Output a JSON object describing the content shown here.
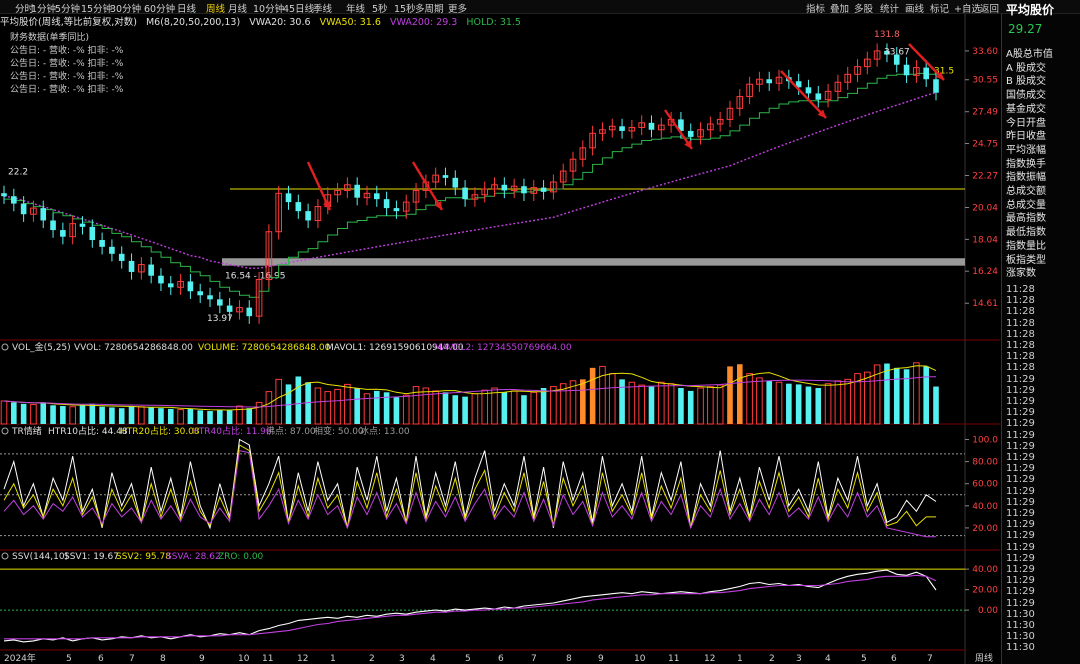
{
  "toolbar": {
    "periods": [
      "分时",
      "1分钟",
      "5分钟",
      "15分钟",
      "30分钟",
      "60分钟",
      "日线",
      "周线",
      "月线",
      "10分钟",
      "45日线",
      "季线",
      "年线",
      "5秒",
      "15秒",
      "多周期",
      "更多"
    ],
    "active": "周线",
    "right_items": [
      "指标",
      "叠加",
      "多股",
      "统计",
      "画线",
      "标记",
      "+自选",
      "返回"
    ]
  },
  "header": {
    "name": "平均股价(周线,等比前复权,对数)",
    "indicator": "M6(8,20,50,200,13)",
    "vwa20": "VWA20: 30.6",
    "vwa50": "VWA50: 31.6",
    "vwa200": "VWA200: 29.3",
    "hold": "HOLD: 31.5"
  },
  "fin_data": {
    "title": "财务数据(单季同比)",
    "rows": [
      "公告日: -   营收: -%   扣非: -%",
      "公告日: -   营收: -%   扣非: -%",
      "公告日: -   营收: -%   扣非: -%",
      "公告日: -   营收: -%   扣非: -%"
    ]
  },
  "right_panel": {
    "title": "平均股价",
    "price": "29.27",
    "items": [
      "A股总市值",
      "A 股成交",
      "B 股成交",
      "国债成交",
      "基金成交",
      "今日开盘",
      "昨日收盘",
      "平均涨幅",
      "指数换手",
      "指数振幅",
      "总成交额",
      "总成交量",
      "最高指数",
      "最低指数",
      "指数量比",
      "板指类型",
      "涨家数"
    ],
    "times": [
      "11:28",
      "11:28",
      "11:28",
      "11:28",
      "11:28",
      "11:28",
      "11:28",
      "11:28",
      "11:29",
      "11:29",
      "11:29",
      "11:29",
      "11:29",
      "11:29",
      "11:29",
      "11:29",
      "11:29",
      "11:29",
      "11:29",
      "11:29",
      "11:29",
      "11:29",
      "11:29",
      "11:29",
      "11:29",
      "11:29",
      "11:29",
      "11:29",
      "11:29",
      "11:30",
      "11:30",
      "11:30",
      "11:30"
    ]
  },
  "colors": {
    "up": "#ff3b3b",
    "down": "#55f0f0",
    "vwa20": "#2db84a",
    "vwa200": "#c040e0",
    "yellow": "#e8e000",
    "orange": "#ff8a2b"
  },
  "chart_data": [
    {
      "type": "candlestick",
      "title": "",
      "price_labels": [
        "33.60",
        "30.55",
        "27.49",
        "24.75",
        "22.27",
        "20.04",
        "18.04",
        "16.24",
        "14.61"
      ],
      "price_values": [
        33.6,
        30.55,
        27.49,
        24.75,
        22.27,
        20.04,
        18.04,
        16.24,
        14.61
      ],
      "ylim": [
        13.2,
        36.0
      ],
      "log_scale": true,
      "x_labels": [
        "2024年",
        "5",
        "6",
        "7",
        "8",
        "9",
        "10",
        "11",
        "12",
        "1",
        "2",
        "3",
        "4",
        "5",
        "6",
        "7",
        "8",
        "9",
        "10",
        "11",
        "12",
        "1",
        "2",
        "3",
        "4",
        "5",
        "6",
        "7"
      ],
      "annotations": [
        "22.2",
        "13.97",
        "16.54 - 16.95",
        "131.8",
        "33.67",
        "31.5"
      ],
      "support_band": [
        16.54,
        16.95
      ],
      "resistance_level": 21.3,
      "weeks": 96,
      "closes": [
        20.8,
        20.3,
        19.6,
        20.0,
        19.2,
        18.6,
        18.2,
        19.0,
        18.8,
        18.0,
        17.6,
        17.2,
        16.8,
        16.2,
        16.6,
        16.0,
        15.6,
        15.4,
        15.7,
        15.2,
        15.0,
        14.8,
        14.5,
        14.2,
        14.4,
        14.0,
        15.8,
        18.5,
        21.0,
        20.4,
        19.8,
        19.2,
        20.1,
        20.9,
        21.2,
        21.6,
        20.7,
        21.0,
        20.6,
        20.0,
        19.8,
        20.4,
        21.2,
        21.8,
        22.3,
        22.1,
        21.4,
        20.6,
        20.9,
        21.3,
        21.6,
        21.2,
        21.5,
        21.0,
        21.4,
        21.1,
        21.8,
        22.6,
        23.5,
        24.4,
        25.6,
        25.9,
        26.2,
        25.8,
        26.1,
        26.5,
        25.9,
        26.3,
        26.8,
        25.8,
        25.3,
        25.9,
        26.4,
        26.8,
        27.8,
        28.9,
        30.1,
        30.6,
        30.2,
        30.8,
        30.4,
        29.8,
        29.2,
        28.6,
        29.4,
        30.3,
        31.1,
        31.9,
        32.7,
        33.6,
        33.2,
        32.1,
        31.0,
        31.8,
        30.6,
        29.27
      ],
      "vwa20": [
        20.6,
        20.5,
        20.3,
        20.1,
        19.9,
        19.7,
        19.5,
        19.3,
        19.1,
        18.9,
        18.7,
        18.4,
        18.2,
        17.9,
        17.6,
        17.3,
        17.0,
        16.7,
        16.5,
        16.2,
        16.0,
        15.7,
        15.4,
        15.2,
        15.0,
        14.9,
        15.2,
        15.9,
        16.6,
        17.0,
        17.3,
        17.5,
        17.9,
        18.3,
        18.7,
        19.1,
        19.2,
        19.4,
        19.5,
        19.5,
        19.5,
        19.6,
        19.9,
        20.2,
        20.5,
        20.7,
        20.7,
        20.6,
        20.7,
        20.8,
        21.0,
        21.0,
        21.1,
        21.1,
        21.2,
        21.2,
        21.3,
        21.6,
        22.0,
        22.5,
        23.1,
        23.6,
        24.1,
        24.4,
        24.7,
        25.0,
        25.1,
        25.2,
        25.3,
        25.2,
        25.1,
        25.1,
        25.2,
        25.4,
        25.8,
        26.3,
        26.9,
        27.4,
        27.8,
        28.2,
        28.4,
        28.5,
        28.5,
        28.4,
        28.5,
        28.8,
        29.2,
        29.7,
        30.2,
        30.7,
        31.0,
        31.1,
        31.1,
        31.2,
        31.1,
        30.9
      ],
      "vwa200": [
        20.8,
        20.7,
        20.5,
        20.3,
        20.1,
        19.9,
        19.7,
        19.5,
        19.3,
        19.1,
        18.9,
        18.7,
        18.5,
        18.3,
        18.1,
        17.9,
        17.7,
        17.5,
        17.3,
        17.1,
        17.0,
        16.8,
        16.7,
        16.6,
        16.5,
        16.4,
        16.4,
        16.5,
        16.6,
        16.7,
        16.8,
        16.9,
        17.0,
        17.1,
        17.2,
        17.3,
        17.4,
        17.5,
        17.6,
        17.7,
        17.8,
        17.9,
        18.0,
        18.1,
        18.2,
        18.3,
        18.4,
        18.5,
        18.6,
        18.7,
        18.8,
        18.9,
        19.0,
        19.1,
        19.2,
        19.3,
        19.4,
        19.6,
        19.8,
        20.0,
        20.2,
        20.4,
        20.6,
        20.8,
        21.0,
        21.2,
        21.4,
        21.6,
        21.8,
        22.0,
        22.2,
        22.4,
        22.6,
        22.8,
        23.0,
        23.3,
        23.6,
        23.9,
        24.2,
        24.5,
        24.8,
        25.1,
        25.4,
        25.7,
        26.0,
        26.3,
        26.6,
        26.9,
        27.2,
        27.5,
        27.8,
        28.1,
        28.4,
        28.7,
        29.0,
        29.3
      ]
    },
    {
      "type": "bar",
      "title": "VOL_金(5,25)",
      "vvol": "VVOL: 7280654286848.00",
      "volume": "VOLUME: 7280654286848.00",
      "mavol1": "MAVOL1: 12691590610944.00",
      "mavol2": "MAVOL2: 12734550769664.00",
      "values": [
        0.32,
        0.3,
        0.28,
        0.27,
        0.3,
        0.26,
        0.25,
        0.24,
        0.26,
        0.28,
        0.24,
        0.23,
        0.22,
        0.25,
        0.24,
        0.23,
        0.22,
        0.21,
        0.2,
        0.21,
        0.19,
        0.18,
        0.2,
        0.19,
        0.25,
        0.22,
        0.3,
        0.45,
        0.62,
        0.55,
        0.66,
        0.58,
        0.5,
        0.45,
        0.48,
        0.55,
        0.5,
        0.42,
        0.46,
        0.44,
        0.38,
        0.4,
        0.52,
        0.5,
        0.46,
        0.44,
        0.4,
        0.38,
        0.42,
        0.47,
        0.5,
        0.44,
        0.46,
        0.4,
        0.44,
        0.5,
        0.52,
        0.56,
        0.6,
        0.62,
        0.78,
        0.8,
        0.7,
        0.62,
        0.58,
        0.54,
        0.52,
        0.58,
        0.56,
        0.5,
        0.46,
        0.5,
        0.52,
        0.54,
        0.8,
        0.83,
        0.7,
        0.64,
        0.6,
        0.58,
        0.56,
        0.55,
        0.52,
        0.5,
        0.56,
        0.6,
        0.62,
        0.7,
        0.72,
        0.82,
        0.84,
        0.78,
        0.76,
        0.85,
        0.8,
        0.52
      ],
      "highlight": [
        59,
        60,
        74,
        75
      ]
    },
    {
      "type": "line",
      "title": "TR情绪",
      "htr10": "HTR10占比: 44.48",
      "htr20": "HTR20占比: 30.08",
      "htr40": "HTR40占比: 11.96",
      "hot": "沸点: 87.00",
      "neutral": "相变: 50.00",
      "cold": "冰点: 13.00",
      "y_labels": [
        "100.0",
        "80.00",
        "60.00",
        "40.00",
        "20.00"
      ],
      "ylim": [
        0,
        105
      ],
      "levels": [
        87,
        50,
        13
      ],
      "series": [
        {
          "name": "HTR10占比",
          "values": [
            55,
            80,
            40,
            60,
            30,
            65,
            45,
            85,
            35,
            55,
            20,
            70,
            40,
            60,
            25,
            75,
            35,
            65,
            30,
            80,
            40,
            20,
            60,
            30,
            100,
            95,
            40,
            60,
            85,
            25,
            70,
            35,
            80,
            45,
            60,
            20,
            75,
            45,
            85,
            35,
            65,
            25,
            85,
            30,
            70,
            40,
            80,
            30,
            65,
            90,
            35,
            60,
            40,
            85,
            30,
            75,
            20,
            80,
            45,
            70,
            25,
            85,
            40,
            60,
            35,
            85,
            30,
            70,
            45,
            80,
            20,
            60,
            40,
            90,
            35,
            65,
            30,
            75,
            45,
            85,
            40,
            55,
            35,
            80,
            30,
            65,
            45,
            85,
            40,
            60,
            25,
            30,
            45,
            35,
            50,
            44
          ]
        },
        {
          "name": "HTR20占比",
          "values": [
            45,
            60,
            38,
            50,
            30,
            55,
            40,
            65,
            32,
            48,
            22,
            55,
            35,
            50,
            25,
            60,
            30,
            55,
            28,
            62,
            35,
            22,
            48,
            28,
            95,
            90,
            35,
            50,
            70,
            25,
            58,
            30,
            65,
            38,
            50,
            20,
            62,
            38,
            70,
            30,
            55,
            25,
            70,
            28,
            58,
            35,
            65,
            28,
            55,
            72,
            30,
            52,
            35,
            70,
            28,
            62,
            22,
            65,
            40,
            58,
            22,
            70,
            35,
            50,
            32,
            70,
            28,
            58,
            38,
            65,
            20,
            50,
            35,
            72,
            32,
            55,
            28,
            62,
            38,
            70,
            35,
            48,
            30,
            65,
            28,
            55,
            38,
            70,
            35,
            52,
            22,
            25,
            35,
            22,
            30,
            30
          ]
        },
        {
          "name": "HTR40占比",
          "values": [
            35,
            45,
            32,
            40,
            28,
            42,
            35,
            48,
            30,
            38,
            24,
            42,
            30,
            38,
            25,
            45,
            28,
            40,
            26,
            46,
            30,
            24,
            38,
            26,
            90,
            88,
            28,
            40,
            55,
            24,
            45,
            28,
            50,
            32,
            40,
            20,
            48,
            32,
            52,
            28,
            42,
            24,
            52,
            26,
            44,
            30,
            48,
            26,
            42,
            55,
            28,
            40,
            30,
            52,
            26,
            46,
            22,
            50,
            32,
            44,
            22,
            52,
            30,
            40,
            28,
            52,
            26,
            44,
            32,
            50,
            20,
            40,
            30,
            55,
            28,
            42,
            26,
            46,
            32,
            52,
            30,
            38,
            28,
            48,
            26,
            42,
            30,
            52,
            30,
            40,
            20,
            18,
            16,
            14,
            12,
            12
          ]
        }
      ]
    },
    {
      "type": "line",
      "title": "SSV(144,10)",
      "ssv1": "SSV1: 19.67",
      "ssv2": "SSV2: 95.78",
      "ssva": "SSVA: 28.62",
      "zro": "ZRO: 0.00",
      "y_labels": [
        "40.00",
        "20.00",
        "0.00"
      ],
      "ylim": [
        -35,
        45
      ],
      "series": [
        {
          "name": "SSV1",
          "values": [
            -30,
            -29,
            -31,
            -30,
            -28,
            -29,
            -27,
            -30,
            -28,
            -27,
            -29,
            -28,
            -26,
            -27,
            -25,
            -27,
            -26,
            -28,
            -26,
            -24,
            -26,
            -25,
            -23,
            -24,
            -22,
            -24,
            -20,
            -18,
            -15,
            -13,
            -10,
            -9,
            -8,
            -7,
            -8,
            -6,
            -7,
            -5,
            -6,
            -4,
            -3,
            -4,
            -2,
            -1,
            0,
            -1,
            1,
            0,
            1,
            2,
            1,
            3,
            2,
            4,
            5,
            6,
            7,
            9,
            11,
            13,
            14,
            15,
            16,
            17,
            16,
            18,
            17,
            16,
            17,
            18,
            17,
            16,
            18,
            19,
            21,
            23,
            26,
            27,
            25,
            26,
            24,
            25,
            23,
            22,
            26,
            30,
            33,
            35,
            36,
            38,
            39,
            35,
            34,
            37,
            33,
            19.67
          ]
        },
        {
          "name": "SSVA",
          "values": [
            -28,
            -28,
            -28,
            -28,
            -28,
            -28,
            -28,
            -28,
            -28,
            -27,
            -27,
            -27,
            -27,
            -27,
            -26,
            -26,
            -26,
            -26,
            -26,
            -25,
            -25,
            -25,
            -25,
            -24,
            -24,
            -24,
            -23,
            -22,
            -21,
            -20,
            -18,
            -16,
            -14,
            -13,
            -11,
            -10,
            -9,
            -8,
            -7,
            -6,
            -5,
            -5,
            -4,
            -3,
            -2,
            -2,
            -1,
            -1,
            0,
            0,
            1,
            1,
            2,
            2,
            3,
            4,
            5,
            6,
            7,
            8,
            10,
            11,
            12,
            13,
            14,
            15,
            15,
            16,
            16,
            16,
            16,
            16,
            17,
            17,
            18,
            19,
            21,
            22,
            23,
            24,
            24,
            24,
            24,
            24,
            25,
            26,
            28,
            29,
            30,
            32,
            33,
            33,
            33,
            34,
            33,
            28.62
          ]
        }
      ]
    }
  ]
}
